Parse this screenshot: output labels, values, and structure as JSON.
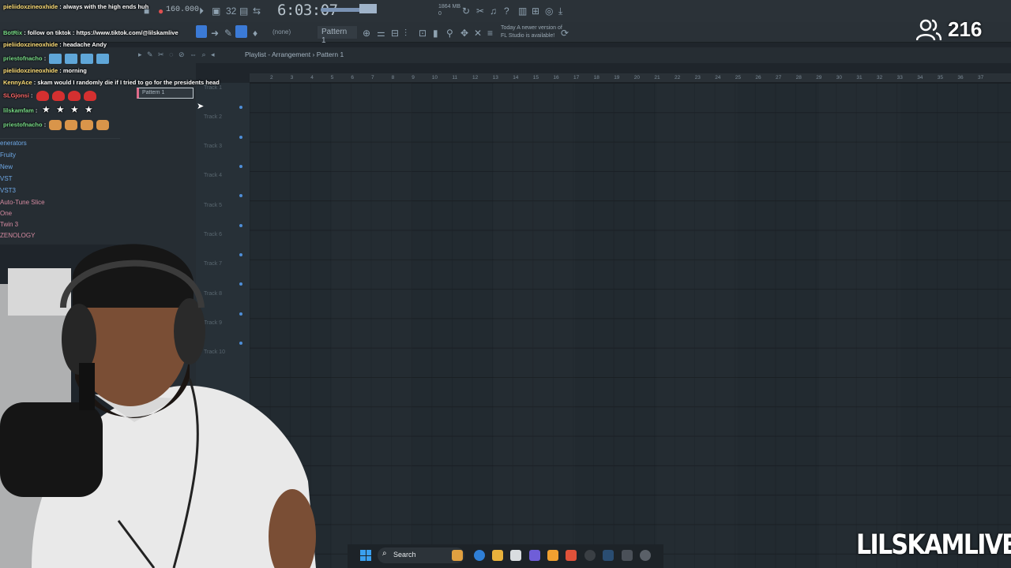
{
  "toolbar": {
    "tempo": "160.000",
    "clock": "6:03:07",
    "memory_line1": "1864 MB",
    "memory_line2": "0",
    "pattern_selector": "Pattern 1",
    "snap_selector": "(none)",
    "update_notice": "Today  A newer version of FL Studio is available!"
  },
  "chat": [
    {
      "user": "pieliidoxzineoxhide",
      "text": ": always with the high ends huh",
      "color": "y"
    },
    {
      "user": "BotRix",
      "text": ": follow on tiktok : https://www.tiktok.com/@lilskamlive",
      "color": "g"
    },
    {
      "user": "pieliidoxzineoxhide",
      "text": ": headache Andy",
      "color": "y"
    },
    {
      "user": "priestofnacho",
      "text": ":",
      "color": "g"
    },
    {
      "user": "pieliidoxzineoxhide",
      "text": ": morning",
      "color": "y"
    },
    {
      "user": "KennyAce",
      "text": ": skam would I randomly die if I tried to go for the presidents head",
      "color": "y"
    },
    {
      "user": "SLGjonsi",
      "text": ":",
      "color": "r"
    },
    {
      "user": "lilskamfam",
      "text": ":",
      "color": "g"
    },
    {
      "user": "priestofnacho",
      "text": ":",
      "color": "g"
    }
  ],
  "browser": {
    "items": [
      {
        "label": "enerators",
        "style": "blue"
      },
      {
        "label": "Fruity",
        "style": "blue"
      },
      {
        "label": "New",
        "style": "blue"
      },
      {
        "label": "VST",
        "style": "blue"
      },
      {
        "label": "VST3",
        "style": "blue"
      },
      {
        "label": "Auto-Tune Slice",
        "style": "pink"
      },
      {
        "label": "One",
        "style": "pink"
      },
      {
        "label": "Twin 3",
        "style": "pink"
      },
      {
        "label": "ZENOLOGY",
        "style": "pink"
      }
    ]
  },
  "playlist": {
    "title": "Playlist - Arrangement › Pattern 1",
    "pattern_item": "Pattern 1",
    "tracks": [
      "Track 1",
      "Track 2",
      "Track 3",
      "Track 4",
      "Track 5",
      "Track 6",
      "Track 7",
      "Track 8",
      "Track 9",
      "Track 10"
    ],
    "ruler": [
      "2",
      "3",
      "4",
      "5",
      "6",
      "7",
      "8",
      "9",
      "10",
      "11",
      "12",
      "13",
      "14",
      "15",
      "16",
      "17",
      "18",
      "19",
      "20",
      "21",
      "22",
      "23",
      "24",
      "25",
      "26",
      "27",
      "28",
      "29",
      "30",
      "31",
      "32",
      "33",
      "34",
      "35",
      "36",
      "37"
    ]
  },
  "stream": {
    "viewer_count": "216",
    "watermark": "LILSKAMLIVE"
  },
  "taskbar": {
    "search_label": "Search"
  }
}
